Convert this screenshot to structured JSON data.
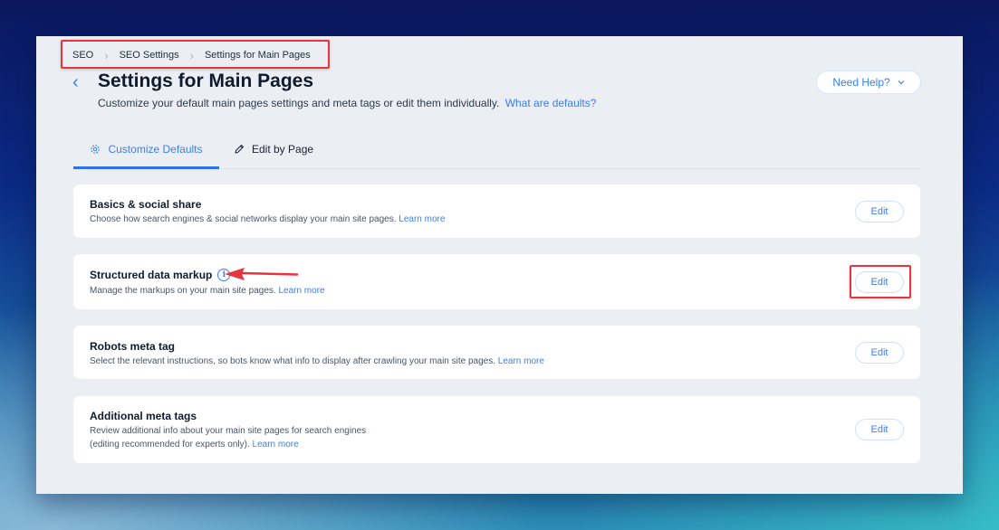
{
  "breadcrumb": [
    "SEO",
    "SEO Settings",
    "Settings for Main Pages"
  ],
  "header": {
    "title": "Settings for Main Pages",
    "subtitle": "Customize your default main pages settings and meta tags or edit them individually.",
    "subtitle_link": "What are defaults?",
    "help_button": "Need Help?"
  },
  "tabs": [
    {
      "label": "Customize Defaults",
      "icon": "gear-icon",
      "active": true
    },
    {
      "label": "Edit by Page",
      "icon": "pencil-icon",
      "active": false
    }
  ],
  "cards": [
    {
      "title": "Basics & social share",
      "description": "Choose how search engines & social networks display your main site pages.",
      "description2": "",
      "link": "Learn more",
      "button": "Edit"
    },
    {
      "title": "Structured data markup",
      "description": "Manage the markups on your main site pages.",
      "description2": "",
      "link": "Learn more",
      "button": "Edit",
      "info_icon": true
    },
    {
      "title": "Robots meta tag",
      "description": "Select the relevant instructions, so bots know what info to display after crawling your main site pages.",
      "description2": "",
      "link": "Learn more",
      "button": "Edit"
    },
    {
      "title": "Additional meta tags",
      "description": "Review additional info about your main site pages for search engines",
      "description2": "(editing recommended for experts only).",
      "link": "Learn more",
      "button": "Edit"
    }
  ],
  "colors": {
    "accent": "#3b7ff0",
    "annotation": "#e8343f"
  }
}
